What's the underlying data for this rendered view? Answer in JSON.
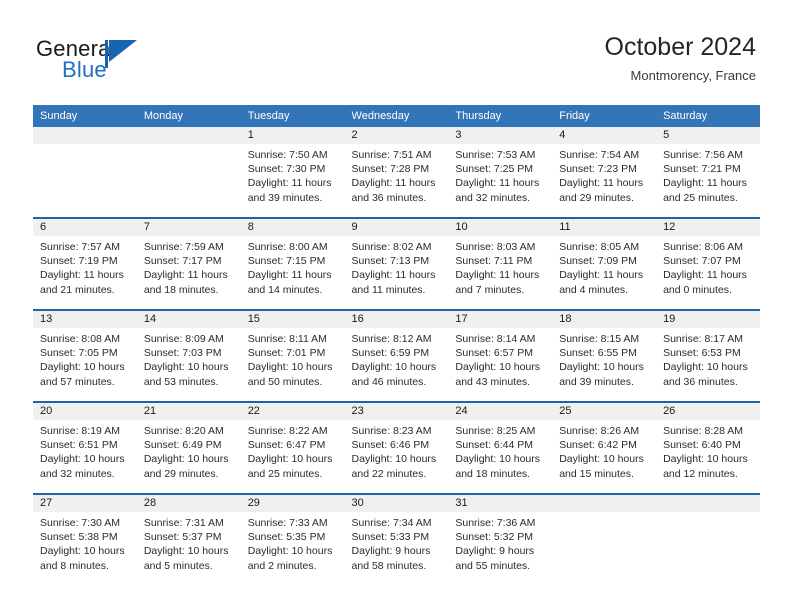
{
  "logo": {
    "word1": "General",
    "word2": "Blue",
    "flag_icon": "blue-flag-triangle-icon",
    "accent_color": "#1565b0"
  },
  "header": {
    "title": "October 2024",
    "subtitle": "Montmorency, France"
  },
  "theme": {
    "header_blue": "#3375b9",
    "row_rule_blue": "#1c63ab",
    "daynum_band": "#f0f0f0"
  },
  "labels": {
    "sunrise": "Sunrise:",
    "sunset": "Sunset:",
    "daylight": "Daylight:"
  },
  "weekdays": [
    "Sunday",
    "Monday",
    "Tuesday",
    "Wednesday",
    "Thursday",
    "Friday",
    "Saturday"
  ],
  "weeks": [
    [
      {
        "day": ""
      },
      {
        "day": ""
      },
      {
        "day": "1",
        "sunrise": "Sunrise: 7:50 AM",
        "sunset": "Sunset: 7:30 PM",
        "daylight_1": "Daylight: 11 hours",
        "daylight_2": "and 39 minutes."
      },
      {
        "day": "2",
        "sunrise": "Sunrise: 7:51 AM",
        "sunset": "Sunset: 7:28 PM",
        "daylight_1": "Daylight: 11 hours",
        "daylight_2": "and 36 minutes."
      },
      {
        "day": "3",
        "sunrise": "Sunrise: 7:53 AM",
        "sunset": "Sunset: 7:25 PM",
        "daylight_1": "Daylight: 11 hours",
        "daylight_2": "and 32 minutes."
      },
      {
        "day": "4",
        "sunrise": "Sunrise: 7:54 AM",
        "sunset": "Sunset: 7:23 PM",
        "daylight_1": "Daylight: 11 hours",
        "daylight_2": "and 29 minutes."
      },
      {
        "day": "5",
        "sunrise": "Sunrise: 7:56 AM",
        "sunset": "Sunset: 7:21 PM",
        "daylight_1": "Daylight: 11 hours",
        "daylight_2": "and 25 minutes."
      }
    ],
    [
      {
        "day": "6",
        "sunrise": "Sunrise: 7:57 AM",
        "sunset": "Sunset: 7:19 PM",
        "daylight_1": "Daylight: 11 hours",
        "daylight_2": "and 21 minutes."
      },
      {
        "day": "7",
        "sunrise": "Sunrise: 7:59 AM",
        "sunset": "Sunset: 7:17 PM",
        "daylight_1": "Daylight: 11 hours",
        "daylight_2": "and 18 minutes."
      },
      {
        "day": "8",
        "sunrise": "Sunrise: 8:00 AM",
        "sunset": "Sunset: 7:15 PM",
        "daylight_1": "Daylight: 11 hours",
        "daylight_2": "and 14 minutes."
      },
      {
        "day": "9",
        "sunrise": "Sunrise: 8:02 AM",
        "sunset": "Sunset: 7:13 PM",
        "daylight_1": "Daylight: 11 hours",
        "daylight_2": "and 11 minutes."
      },
      {
        "day": "10",
        "sunrise": "Sunrise: 8:03 AM",
        "sunset": "Sunset: 7:11 PM",
        "daylight_1": "Daylight: 11 hours",
        "daylight_2": "and 7 minutes."
      },
      {
        "day": "11",
        "sunrise": "Sunrise: 8:05 AM",
        "sunset": "Sunset: 7:09 PM",
        "daylight_1": "Daylight: 11 hours",
        "daylight_2": "and 4 minutes."
      },
      {
        "day": "12",
        "sunrise": "Sunrise: 8:06 AM",
        "sunset": "Sunset: 7:07 PM",
        "daylight_1": "Daylight: 11 hours",
        "daylight_2": "and 0 minutes."
      }
    ],
    [
      {
        "day": "13",
        "sunrise": "Sunrise: 8:08 AM",
        "sunset": "Sunset: 7:05 PM",
        "daylight_1": "Daylight: 10 hours",
        "daylight_2": "and 57 minutes."
      },
      {
        "day": "14",
        "sunrise": "Sunrise: 8:09 AM",
        "sunset": "Sunset: 7:03 PM",
        "daylight_1": "Daylight: 10 hours",
        "daylight_2": "and 53 minutes."
      },
      {
        "day": "15",
        "sunrise": "Sunrise: 8:11 AM",
        "sunset": "Sunset: 7:01 PM",
        "daylight_1": "Daylight: 10 hours",
        "daylight_2": "and 50 minutes."
      },
      {
        "day": "16",
        "sunrise": "Sunrise: 8:12 AM",
        "sunset": "Sunset: 6:59 PM",
        "daylight_1": "Daylight: 10 hours",
        "daylight_2": "and 46 minutes."
      },
      {
        "day": "17",
        "sunrise": "Sunrise: 8:14 AM",
        "sunset": "Sunset: 6:57 PM",
        "daylight_1": "Daylight: 10 hours",
        "daylight_2": "and 43 minutes."
      },
      {
        "day": "18",
        "sunrise": "Sunrise: 8:15 AM",
        "sunset": "Sunset: 6:55 PM",
        "daylight_1": "Daylight: 10 hours",
        "daylight_2": "and 39 minutes."
      },
      {
        "day": "19",
        "sunrise": "Sunrise: 8:17 AM",
        "sunset": "Sunset: 6:53 PM",
        "daylight_1": "Daylight: 10 hours",
        "daylight_2": "and 36 minutes."
      }
    ],
    [
      {
        "day": "20",
        "sunrise": "Sunrise: 8:19 AM",
        "sunset": "Sunset: 6:51 PM",
        "daylight_1": "Daylight: 10 hours",
        "daylight_2": "and 32 minutes."
      },
      {
        "day": "21",
        "sunrise": "Sunrise: 8:20 AM",
        "sunset": "Sunset: 6:49 PM",
        "daylight_1": "Daylight: 10 hours",
        "daylight_2": "and 29 minutes."
      },
      {
        "day": "22",
        "sunrise": "Sunrise: 8:22 AM",
        "sunset": "Sunset: 6:47 PM",
        "daylight_1": "Daylight: 10 hours",
        "daylight_2": "and 25 minutes."
      },
      {
        "day": "23",
        "sunrise": "Sunrise: 8:23 AM",
        "sunset": "Sunset: 6:46 PM",
        "daylight_1": "Daylight: 10 hours",
        "daylight_2": "and 22 minutes."
      },
      {
        "day": "24",
        "sunrise": "Sunrise: 8:25 AM",
        "sunset": "Sunset: 6:44 PM",
        "daylight_1": "Daylight: 10 hours",
        "daylight_2": "and 18 minutes."
      },
      {
        "day": "25",
        "sunrise": "Sunrise: 8:26 AM",
        "sunset": "Sunset: 6:42 PM",
        "daylight_1": "Daylight: 10 hours",
        "daylight_2": "and 15 minutes."
      },
      {
        "day": "26",
        "sunrise": "Sunrise: 8:28 AM",
        "sunset": "Sunset: 6:40 PM",
        "daylight_1": "Daylight: 10 hours",
        "daylight_2": "and 12 minutes."
      }
    ],
    [
      {
        "day": "27",
        "sunrise": "Sunrise: 7:30 AM",
        "sunset": "Sunset: 5:38 PM",
        "daylight_1": "Daylight: 10 hours",
        "daylight_2": "and 8 minutes."
      },
      {
        "day": "28",
        "sunrise": "Sunrise: 7:31 AM",
        "sunset": "Sunset: 5:37 PM",
        "daylight_1": "Daylight: 10 hours",
        "daylight_2": "and 5 minutes."
      },
      {
        "day": "29",
        "sunrise": "Sunrise: 7:33 AM",
        "sunset": "Sunset: 5:35 PM",
        "daylight_1": "Daylight: 10 hours",
        "daylight_2": "and 2 minutes."
      },
      {
        "day": "30",
        "sunrise": "Sunrise: 7:34 AM",
        "sunset": "Sunset: 5:33 PM",
        "daylight_1": "Daylight: 9 hours",
        "daylight_2": "and 58 minutes."
      },
      {
        "day": "31",
        "sunrise": "Sunrise: 7:36 AM",
        "sunset": "Sunset: 5:32 PM",
        "daylight_1": "Daylight: 9 hours",
        "daylight_2": "and 55 minutes."
      },
      {
        "day": ""
      },
      {
        "day": ""
      }
    ]
  ]
}
